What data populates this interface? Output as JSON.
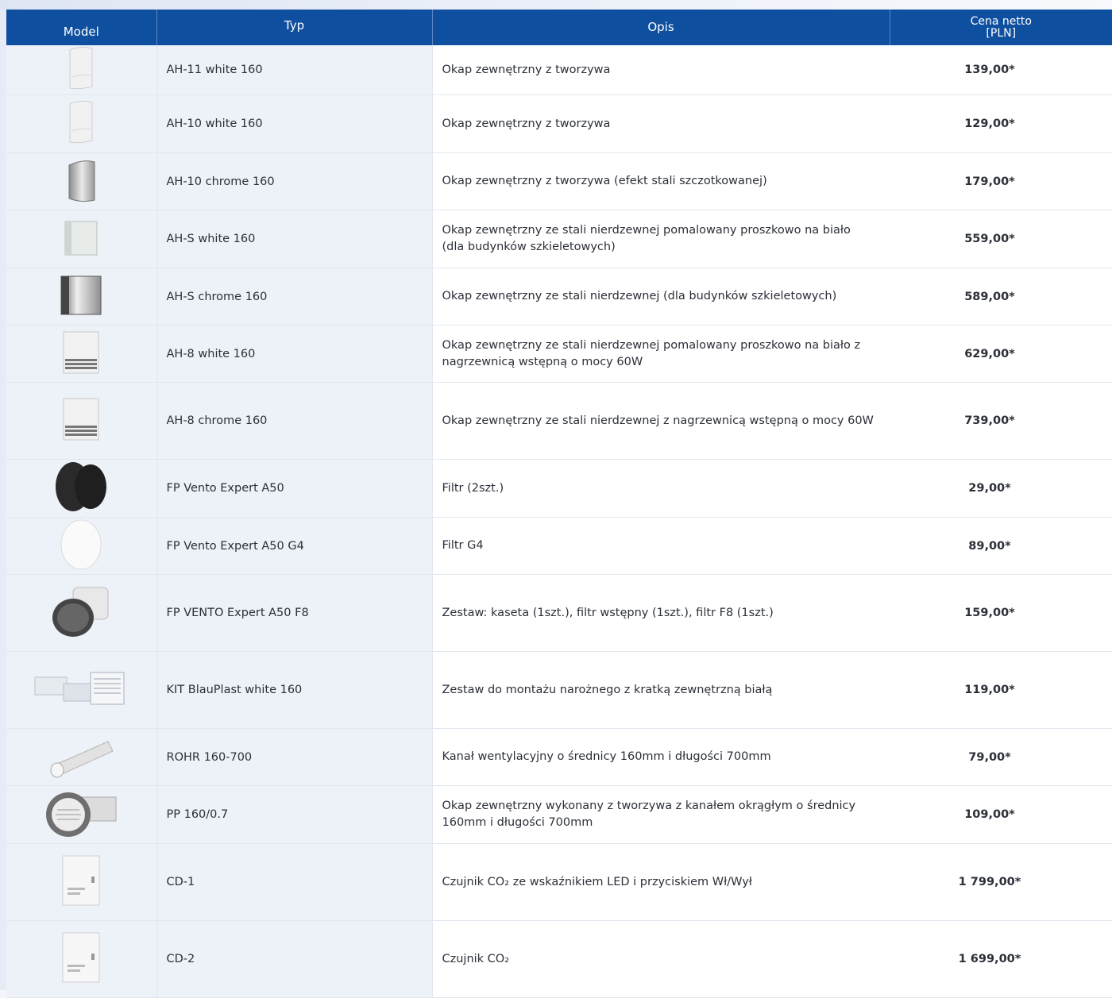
{
  "table": {
    "headers": {
      "model": "Model",
      "typ": "Typ",
      "opis": "Opis",
      "price_line1": "Cena netto",
      "price_line2": "[PLN]"
    },
    "rows": [
      {
        "icon": "white-hood-icon",
        "typ": "AH-11 white 160",
        "opis": "Okap zewnętrzny z tworzywa",
        "price": "139,00*"
      },
      {
        "icon": "white-hood-icon",
        "typ": "AH-10 white 160",
        "opis": "Okap zewnętrzny z tworzywa",
        "price": "129,00*"
      },
      {
        "icon": "chrome-hood-icon",
        "typ": "AH-10 chrome 160",
        "opis": "Okap zewnętrzny z tworzywa (efekt stali szczotkowanej)",
        "price": "179,00*"
      },
      {
        "icon": "white-box-hood-icon",
        "typ": "AH-S white 160",
        "opis": "Okap zewnętrzny ze stali nierdzewnej pomalowany proszkowo na biało (dla budynków szkieletowych)",
        "price": "559,00*"
      },
      {
        "icon": "chrome-box-hood-icon",
        "typ": "AH-S chrome 160",
        "opis": "Okap zewnętrzny ze stali nierdzewnej  (dla budynków szkieletowych)",
        "price": "589,00*"
      },
      {
        "icon": "louvre-hood-icon",
        "typ": "AH-8 white 160",
        "opis": "Okap zewnętrzny ze stali nierdzewnej pomalowany proszkowo na biało z nagrzewnicą wstępną o mocy 60W",
        "price": "629,00*"
      },
      {
        "icon": "louvre-hood-icon",
        "typ": "AH-8 chrome 160",
        "opis": "Okap zewnętrzny ze stali nierdzewnej  z nagrzewnicą wstępną o mocy 60W",
        "price": "739,00*"
      },
      {
        "icon": "black-filter-discs-icon",
        "typ": "FP Vento Expert A50",
        "opis": "Filtr (2szt.)",
        "price": "29,00*"
      },
      {
        "icon": "white-filter-disc-icon",
        "typ": "FP Vento Expert A50 G4",
        "opis": "Filtr G4",
        "price": "89,00*"
      },
      {
        "icon": "filter-cassette-icon",
        "typ": "FP VENTO Expert A50 F8",
        "opis": "Zestaw: kaseta (1szt.), filtr wstępny (1szt.), filtr F8 (1szt.)",
        "price": "159,00*"
      },
      {
        "icon": "corner-kit-icon",
        "typ": "KIT BlauPlast white 160",
        "opis": "Zestaw do montażu narożnego z kratką zewnętrzną białą",
        "price": "119,00*"
      },
      {
        "icon": "duct-pipe-icon",
        "typ": "ROHR 160-700",
        "opis": "Kanał wentylacyjny o średnicy 160mm i długości 700mm",
        "price": "79,00*"
      },
      {
        "icon": "pipe-with-grille-icon",
        "typ": "PP 160/0.7",
        "opis": "Okap zewnętrzny wykonany z tworzywa z kanałem okrągłym o średnicy 160mm i długości 700mm",
        "price": "109,00*"
      },
      {
        "icon": "co2-sensor-icon",
        "typ": "CD-1",
        "opis": "Czujnik CO₂ ze wskaźnikiem LED i przyciskiem Wł/Wył",
        "price": "1 799,00*"
      },
      {
        "icon": "co2-sensor-icon",
        "typ": "CD-2",
        "opis": "Czujnik CO₂",
        "price": "1 699,00*"
      }
    ]
  }
}
